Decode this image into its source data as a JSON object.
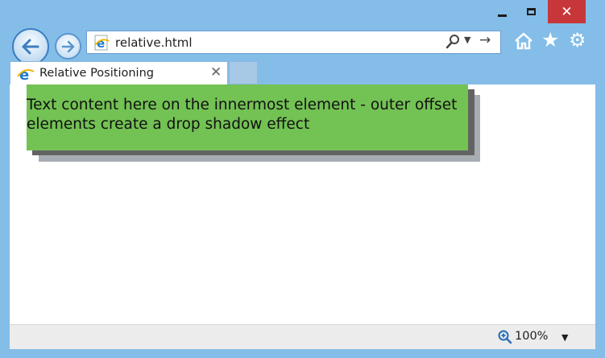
{
  "window": {
    "minimize_icon": "minimize-icon",
    "maximize_icon": "maximize-icon",
    "close_glyph": "✕"
  },
  "toolbar": {
    "back_icon": "back-arrow-icon",
    "forward_icon": "forward-arrow-icon",
    "address": "relative.html",
    "search_icon": "search-icon",
    "go_glyph": "→",
    "home_icon": "home-icon",
    "star_glyph": "★",
    "gear_glyph": "⚙"
  },
  "tabs": [
    {
      "label": "Relative Positioning",
      "close_glyph": "✕"
    }
  ],
  "content": {
    "text": "Text content here on the innermost element - outer offset elements create a drop shadow effect"
  },
  "status": {
    "zoom": "100%"
  },
  "colors": {
    "frame": "#83bde8",
    "close": "#c7373a",
    "panel_green": "#73c254",
    "shadow_dark": "#636363",
    "shadow_light": "#a8adb3"
  }
}
